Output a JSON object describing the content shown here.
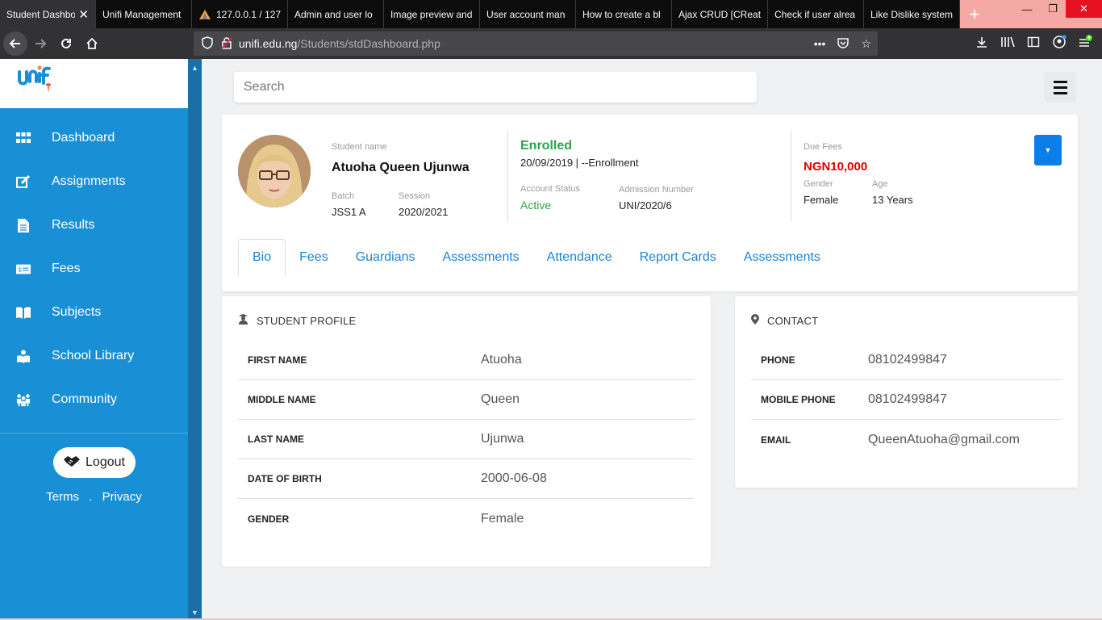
{
  "browser": {
    "tabs": [
      {
        "title": "Student Dashbo",
        "active": true
      },
      {
        "title": "Unifi Management"
      },
      {
        "title": "127.0.0.1 / 127"
      },
      {
        "title": "Admin and user lo"
      },
      {
        "title": "Image preview and"
      },
      {
        "title": "User account man"
      },
      {
        "title": "How to create a bl"
      },
      {
        "title": "Ajax CRUD [CReat"
      },
      {
        "title": "Check if user alrea"
      },
      {
        "title": "Like Dislike system"
      }
    ],
    "new_tab": "+",
    "url_domain": "unifi.edu.ng",
    "url_path": "/Students/stdDashboard.php"
  },
  "sidebar": {
    "logo": "unif",
    "items": [
      {
        "label": "Dashboard",
        "icon": "grid-icon"
      },
      {
        "label": "Assignments",
        "icon": "edit-icon"
      },
      {
        "label": "Results",
        "icon": "document-icon"
      },
      {
        "label": "Fees",
        "icon": "money-icon"
      },
      {
        "label": "Subjects",
        "icon": "book-icon"
      },
      {
        "label": "School Library",
        "icon": "reader-icon"
      },
      {
        "label": "Community",
        "icon": "people-icon"
      }
    ],
    "logout": "Logout",
    "terms": "Terms",
    "separator": ".",
    "privacy": "Privacy"
  },
  "header": {
    "search_placeholder": "Search"
  },
  "profile": {
    "name_label": "Student name",
    "name": "Atuoha Queen Ujunwa",
    "batch_label": "Batch",
    "batch": "JSS1 A",
    "session_label": "Session",
    "session": "2020/2021",
    "enrolled": "Enrolled",
    "enroll_info": "20/09/2019 | --Enrollment",
    "account_status_label": "Account Status",
    "account_status": "Active",
    "admission_label": "Admission Number",
    "admission": "UNI/2020/6",
    "due_fees_label": "Due Fees",
    "due_fees": "NGN10,000",
    "gender_label": "Gender",
    "gender": "Female",
    "age_label": "Age",
    "age": "13 Years",
    "tabs": [
      "Bio",
      "Fees",
      "Guardians",
      "Assessments",
      "Attendance",
      "Report Cards",
      "Assessments"
    ]
  },
  "bio": {
    "title": "STUDENT PROFILE",
    "rows": [
      {
        "key": "FIRST NAME",
        "value": "Atuoha"
      },
      {
        "key": "MIDDLE NAME",
        "value": "Queen"
      },
      {
        "key": "LAST NAME",
        "value": "Ujunwa"
      },
      {
        "key": "DATE OF BIRTH",
        "value": "2000-06-08"
      },
      {
        "key": "GENDER",
        "value": "Female"
      }
    ]
  },
  "contact": {
    "title": "CONTACT",
    "rows": [
      {
        "key": "PHONE",
        "value": "08102499847"
      },
      {
        "key": "MOBILE PHONE",
        "value": "08102499847"
      },
      {
        "key": "EMAIL",
        "value": "QueenAtuoha@gmail.com"
      }
    ]
  },
  "colors": {
    "sidebar": "#1990d5",
    "enrolled": "#28a745",
    "due": "#e00000",
    "link": "#1a84d8"
  }
}
